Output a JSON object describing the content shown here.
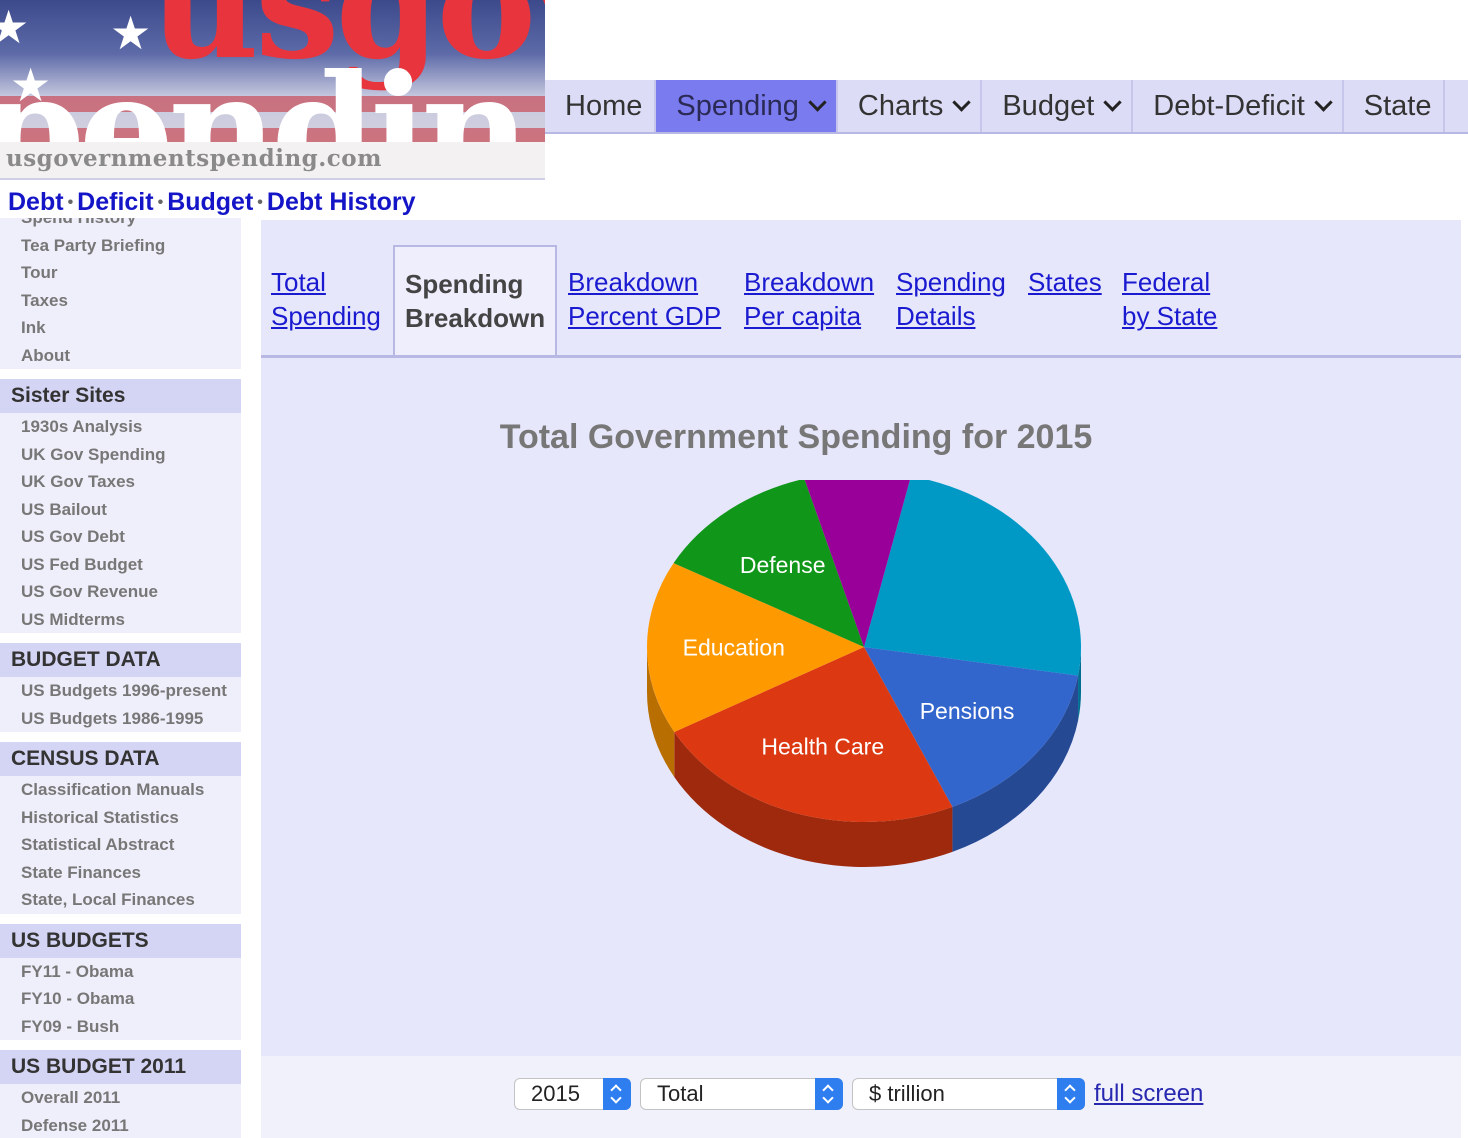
{
  "logo": {
    "line1": "usgov",
    "line2": "pendin",
    "url": "usgovernmentspending.com"
  },
  "topnav": [
    {
      "label": "Home",
      "dropdown": false,
      "active": false
    },
    {
      "label": "Spending",
      "dropdown": true,
      "active": true
    },
    {
      "label": "Charts",
      "dropdown": true,
      "active": false
    },
    {
      "label": "Budget",
      "dropdown": true,
      "active": false
    },
    {
      "label": "Debt-Deficit",
      "dropdown": true,
      "active": false
    },
    {
      "label": "State",
      "dropdown": false,
      "active": false
    }
  ],
  "crumbs": {
    "debt": "Debt",
    "deficit": "Deficit",
    "budget": "Budget",
    "history": "Debt History",
    "sep": "•"
  },
  "sidebar": {
    "top_items": [
      "Spend History",
      "Tea Party Briefing",
      "Tour",
      "Taxes",
      "Ink",
      "About"
    ],
    "sister": {
      "title": "Sister Sites",
      "items": [
        "1930s Analysis",
        "UK Gov Spending",
        "UK Gov Taxes",
        "US Bailout",
        "US Gov Debt",
        "US Fed Budget",
        "US Gov Revenue",
        "US Midterms"
      ]
    },
    "budget_data": {
      "title": "BUDGET DATA",
      "items": [
        "US Budgets 1996-present",
        "US Budgets 1986-1995"
      ]
    },
    "census": {
      "title": "CENSUS DATA",
      "items": [
        "Classification Manuals",
        "Historical Statistics",
        "Statistical Abstract",
        "State Finances",
        "State, Local Finances"
      ]
    },
    "us_budgets": {
      "title": "US BUDGETS",
      "items": [
        "FY11 - Obama",
        "FY10 - Obama",
        "FY09 - Bush"
      ]
    },
    "budget2011": {
      "title": "US BUDGET 2011",
      "items": [
        "Overall 2011",
        "Defense 2011"
      ]
    }
  },
  "tabs": {
    "total": [
      "Total",
      "Spending"
    ],
    "breakdown": [
      "Spending",
      "Breakdown"
    ],
    "gdp": [
      "Breakdown",
      "Percent GDP"
    ],
    "capita": [
      "Breakdown",
      "Per capita"
    ],
    "details": [
      "Spending",
      "Details"
    ],
    "states": [
      "States"
    ],
    "federal": [
      "Federal",
      "by State"
    ]
  },
  "chart_data": {
    "type": "pie",
    "title": "Total Government Spending for 2015",
    "slices": [
      {
        "label": "",
        "value": 22.6,
        "color": "#0099c6"
      },
      {
        "label": "Pensions",
        "value": 14.7,
        "color": "#3366cc"
      },
      {
        "label": "Health Care",
        "value": 22.1,
        "color": "#dc3912"
      },
      {
        "label": "Education",
        "value": 15.0,
        "color": "#ff9900"
      },
      {
        "label": "Defense",
        "value": 11.8,
        "color": "#109618"
      },
      {
        "label": "",
        "value": 7.4,
        "color": "#990099"
      }
    ]
  },
  "controls": {
    "year": "2015",
    "scope": "Total",
    "unit": "$ trillion",
    "fullscreen": "full screen"
  }
}
